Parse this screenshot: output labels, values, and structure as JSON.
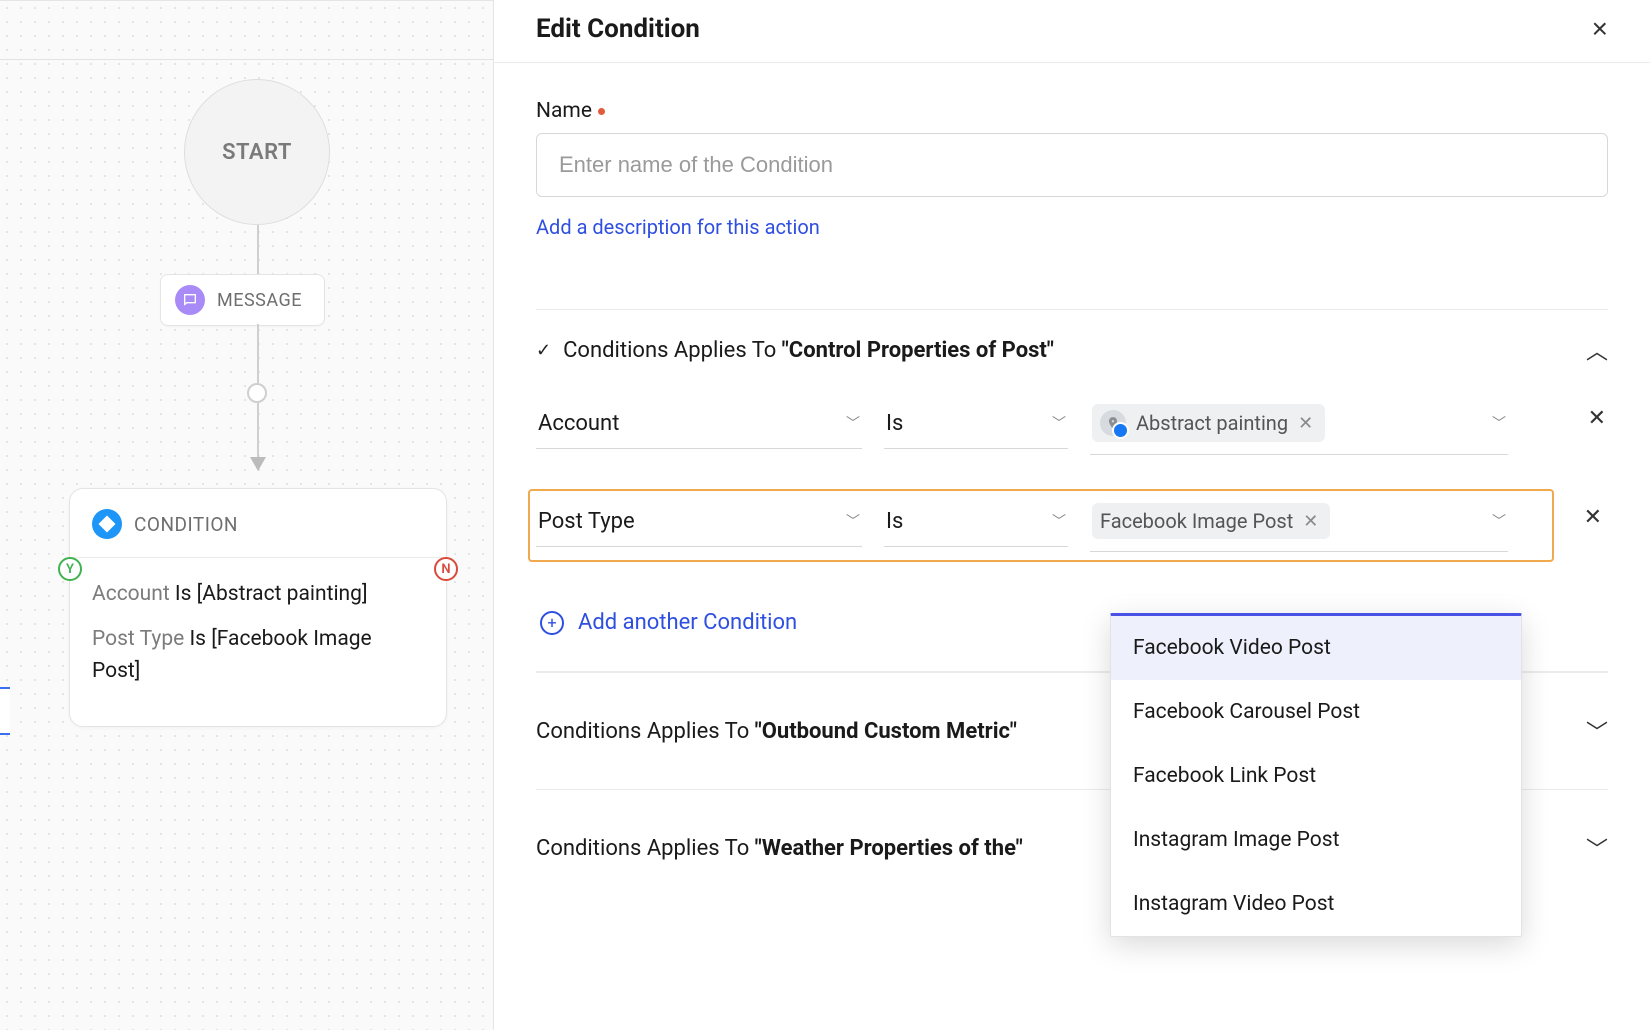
{
  "panel": {
    "title": "Edit Condition",
    "close": "×"
  },
  "form": {
    "name_label": "Name",
    "name_placeholder": "Enter name of the Condition",
    "add_description": "Add a description for this action"
  },
  "sections": {
    "s1": {
      "prefix": "Conditions Applies To ",
      "target": "\"Control Properties of Post\"",
      "expanded": true,
      "rows": [
        {
          "field": "Account",
          "operator": "Is",
          "chip_label": "Abstract painting",
          "has_avatar": true
        },
        {
          "field": "Post Type",
          "operator": "Is",
          "chip_label": "Facebook Image Post",
          "has_avatar": false,
          "highlight": true
        }
      ],
      "add_another": "Add another Condition"
    },
    "s2": {
      "prefix": "Conditions Applies To ",
      "target": "\"Outbound Custom Metric\""
    },
    "s3": {
      "prefix": "Conditions Applies To ",
      "target": "\"Weather Properties of the\""
    }
  },
  "dropdown": {
    "options": [
      "Facebook Video Post",
      "Facebook Carousel Post",
      "Facebook Link Post",
      "Instagram Image Post",
      "Instagram Video Post"
    ],
    "highlighted_index": 0
  },
  "flow": {
    "start": "START",
    "message_label": "MESSAGE",
    "condition_label": "CONDITION",
    "badge_y": "Y",
    "badge_n": "N",
    "cond_lines": {
      "l1_field": "Account",
      "l1_rest": " Is [Abstract painting]",
      "l2_field": "Post Type",
      "l2_rest": " Is [Facebook Image Post]"
    }
  }
}
